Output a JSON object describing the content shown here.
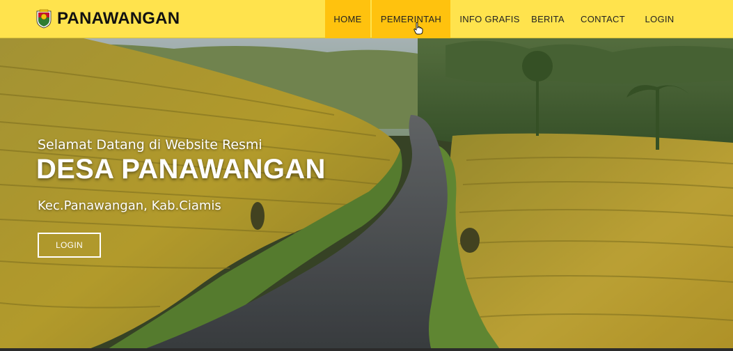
{
  "brand": {
    "name": "PANAWANGAN",
    "logo_icon": "crest-icon"
  },
  "nav": {
    "items": [
      {
        "label": "HOME",
        "state": "active"
      },
      {
        "label": "PEMERINTAH",
        "state": "hover"
      },
      {
        "label": "INFO GRAFIS",
        "state": ""
      },
      {
        "label": "BERITA",
        "state": ""
      },
      {
        "label": "CONTACT",
        "state": ""
      },
      {
        "label": "LOGIN",
        "state": ""
      }
    ]
  },
  "hero": {
    "greeting": "Selamat Datang di Website Resmi",
    "title": "DESA PANAWANGAN",
    "subtitle": "Kec.Panawangan, Kab.Ciamis",
    "button_label": "LOGIN"
  },
  "colors": {
    "navbar_bg": "#ffe34d",
    "nav_active_bg": "#ffc20e",
    "text_dark": "#111111",
    "hero_text": "#ffffff"
  }
}
